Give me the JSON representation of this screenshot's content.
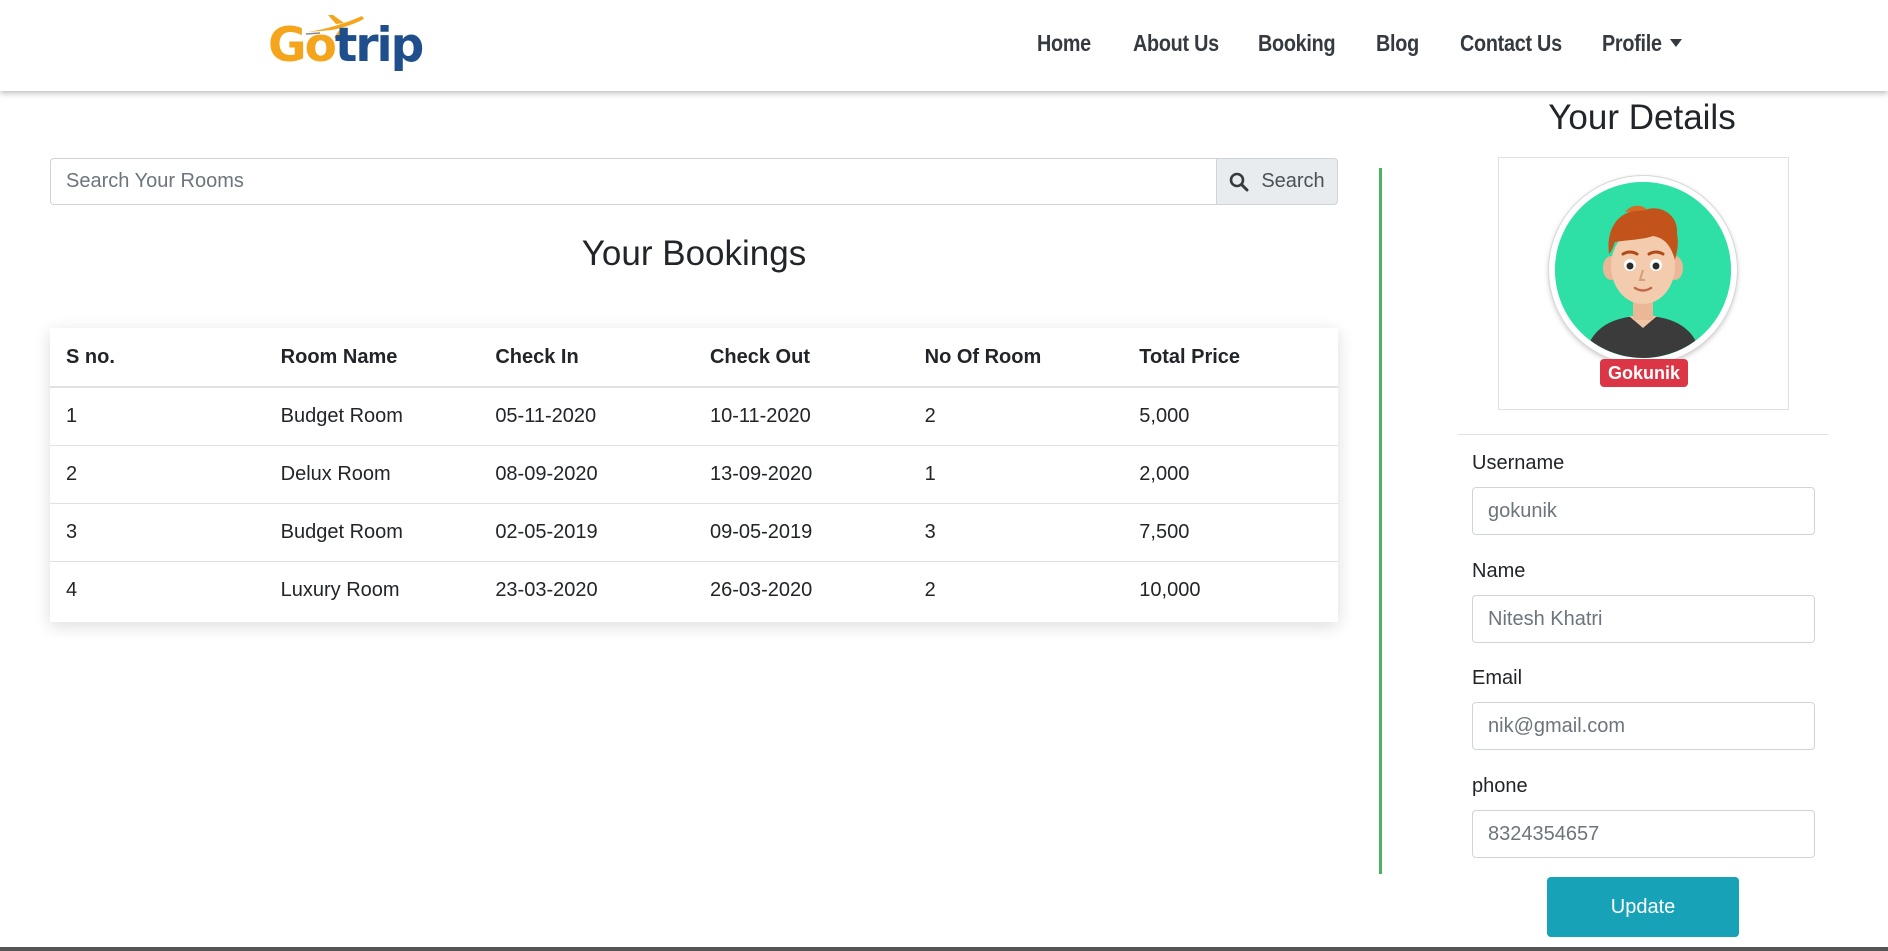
{
  "brand": {
    "logo_part1": "Go",
    "logo_part2": "trip"
  },
  "nav": {
    "items": [
      {
        "label": "Home"
      },
      {
        "label": "About Us"
      },
      {
        "label": "Booking"
      },
      {
        "label": "Blog"
      },
      {
        "label": "Contact Us"
      },
      {
        "label": "Profile"
      }
    ]
  },
  "search": {
    "placeholder": "Search Your Rooms",
    "value": "",
    "button_label": "Search",
    "icon": "search-icon"
  },
  "bookings": {
    "title": "Your Bookings",
    "columns": [
      "S no.",
      "Room Name",
      "Check In",
      "Check Out",
      "No Of Room",
      "Total Price"
    ],
    "rows": [
      [
        "1",
        "Budget Room",
        "05-11-2020",
        "10-11-2020",
        "2",
        "5,000"
      ],
      [
        "2",
        "Delux Room",
        "08-09-2020",
        "13-09-2020",
        "1",
        "2,000"
      ],
      [
        "3",
        "Budget Room",
        "02-05-2019",
        "09-05-2019",
        "3",
        "7,500"
      ],
      [
        "4",
        "Luxury Room",
        "23-03-2020",
        "26-03-2020",
        "2",
        "10,000"
      ]
    ]
  },
  "details": {
    "title": "Your Details",
    "badge": "Gokunik",
    "fields": [
      {
        "label": "Username",
        "placeholder": "gokunik"
      },
      {
        "label": "Name",
        "placeholder": "Nitesh Khatri"
      },
      {
        "label": "Email",
        "placeholder": "nik@gmail.com"
      },
      {
        "label": "phone",
        "placeholder": "8324354657"
      }
    ],
    "update_label": "Update"
  },
  "colors": {
    "accent_green": "#28a745",
    "badge_red": "#dc3545",
    "button_teal": "#17a2b8",
    "logo_orange": "#f5a51c",
    "logo_blue": "#1f4e8c"
  }
}
